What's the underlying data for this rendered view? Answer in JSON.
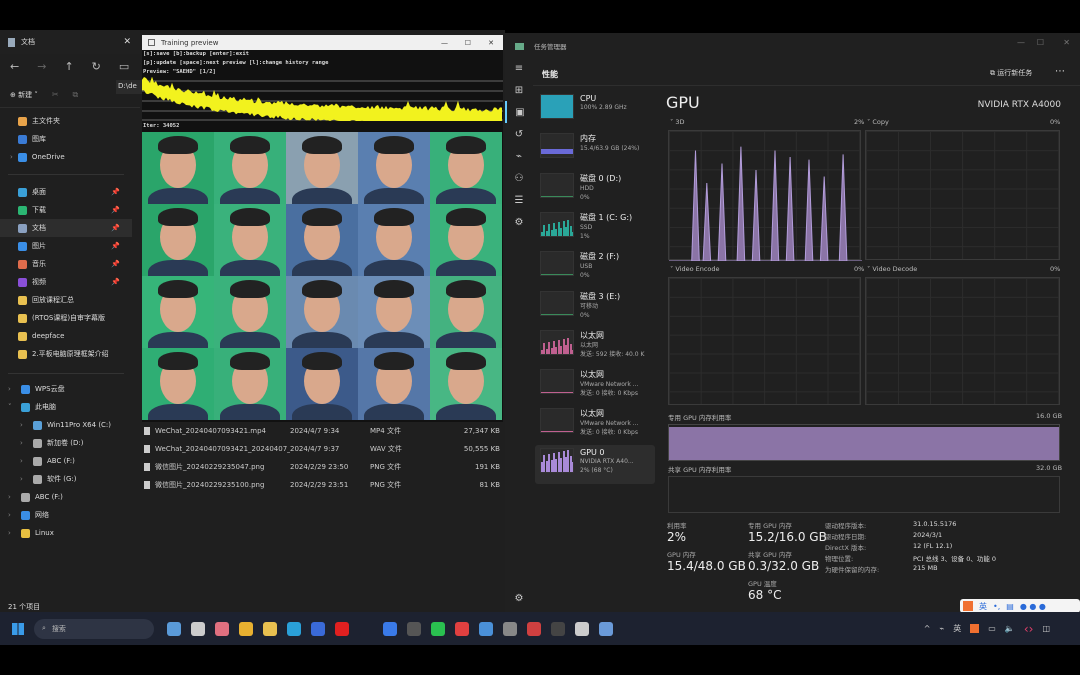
{
  "explorer": {
    "title": "文档",
    "path": "D:\\de",
    "new_label": "新建",
    "quick": [
      {
        "label": "主文件夹",
        "color": "#e8a34a"
      },
      {
        "label": "图库",
        "color": "#3a7bd5"
      },
      {
        "label": "OneDrive",
        "color": "#3a8ee6"
      }
    ],
    "pinned": [
      {
        "label": "桌面",
        "color": "#3aa0d8"
      },
      {
        "label": "下载",
        "color": "#2bb673"
      },
      {
        "label": "文档",
        "color": "#8aa0c0"
      },
      {
        "label": "图片",
        "color": "#3a8ee6"
      },
      {
        "label": "音乐",
        "color": "#e06c4c"
      },
      {
        "label": "视频",
        "color": "#8a4fd8"
      }
    ],
    "folders": [
      "回放课程汇总",
      "(RTOS课程)自审字幕版",
      "deepface",
      "2.平板电脑原理框架介绍"
    ],
    "tree": [
      "WPS云盘",
      "此电脑",
      "Win11Pro X64 (C:)",
      "新加卷 (D:)",
      "ABC (F:)",
      "软件 (G:)",
      "ABC (F:)",
      "网络",
      "Linux"
    ],
    "status": "21 个项目",
    "files": [
      {
        "name": "WeChat_20240407093421.mp4",
        "date": "2024/4/7 9:34",
        "type": "MP4 文件",
        "size": "27,347 KB"
      },
      {
        "name": "WeChat_20240407093421_20240407_...",
        "date": "2024/4/7 9:37",
        "type": "WAV 文件",
        "size": "50,555 KB"
      },
      {
        "name": "微信图片_20240229235047.png",
        "date": "2024/2/29 23:50",
        "type": "PNG 文件",
        "size": "191 KB"
      },
      {
        "name": "微信图片_20240229235100.png",
        "date": "2024/2/29 23:51",
        "type": "PNG 文件",
        "size": "81 KB"
      }
    ]
  },
  "training": {
    "title": "Training preview",
    "line1": "[s]:save [b]:backup [enter]:exit",
    "line2": "[p]:update [space]:next preview [l]:change history range",
    "line3": "Preview: \"SAEHD\" [1/2]",
    "iter": "Iter: 34052",
    "loss_color": "#f2f21e",
    "face_bgs": [
      "#2aa56a",
      "#37b07a",
      "#8aa0b0",
      "#5a7fb0",
      "#38b07a",
      "#2aa56a",
      "#3ab27c",
      "#4a6fa0",
      "#5a7fb0",
      "#3ab27c",
      "#36b579",
      "#3ab27c",
      "#6a8ab0",
      "#6c8eb8",
      "#44b280",
      "#2fae74",
      "#38b07a",
      "#3c5a8a",
      "#5577a8",
      "#48b784"
    ]
  },
  "taskmgr": {
    "title": "任务管理器",
    "section": "性能",
    "run_task": "运行新任务",
    "items": [
      {
        "name": "CPU",
        "l2": "100% 2.89 GHz",
        "l3": "",
        "color": "#2aa1b8"
      },
      {
        "name": "内存",
        "l2": "15.4/63.9 GB (24%)",
        "l3": "",
        "color": "#6a6ad8"
      },
      {
        "name": "磁盘 0 (D:)",
        "l2": "HDD",
        "l3": "0%",
        "color": "#3a8a5a"
      },
      {
        "name": "磁盘 1 (C: G:)",
        "l2": "SSD",
        "l3": "1%",
        "color": "#2aa898"
      },
      {
        "name": "磁盘 2 (F:)",
        "l2": "USB",
        "l3": "0%",
        "color": "#3a8a5a"
      },
      {
        "name": "磁盘 3 (E:)",
        "l2": "可移动",
        "l3": "0%",
        "color": "#3a8a5a"
      },
      {
        "name": "以太网",
        "l2": "以太网",
        "l3": "发送: 592 接收: 40.0 K",
        "color": "#c06090"
      },
      {
        "name": "以太网",
        "l2": "VMware Network ...",
        "l3": "发送: 0 接收: 0 Kbps",
        "color": "#c06090"
      },
      {
        "name": "以太网",
        "l2": "VMware Network ...",
        "l3": "发送: 0 接收: 0 Kbps",
        "color": "#c06090"
      },
      {
        "name": "GPU 0",
        "l2": "NVIDIA RTX A40...",
        "l3": "2% (68 °C)",
        "color": "#a98ad8"
      }
    ],
    "gpu": {
      "title": "GPU",
      "model": "NVIDIA RTX A4000",
      "g3d": "3D",
      "g3d_pct": "2%",
      "copy": "Copy",
      "copy_pct": "0%",
      "venc": "Video Encode",
      "venc_pct": "0%",
      "vdec": "Video Decode",
      "vdec_pct": "0%",
      "ded_label": "专用 GPU 内存利用率",
      "ded_max": "16.0 GB",
      "ded_fill": 0.95,
      "sh_label": "共享 GPU 内存利用率",
      "sh_max": "32.0 GB",
      "history_3d_pct": [
        0,
        0,
        0,
        0,
        0,
        0,
        0,
        85,
        0,
        0,
        60,
        0,
        0,
        0,
        75,
        0,
        0,
        0,
        0,
        88,
        0,
        0,
        0,
        70,
        0,
        0,
        0,
        0,
        85,
        0,
        0,
        0,
        80,
        0,
        0,
        0,
        0,
        78,
        0,
        0,
        0,
        65,
        0,
        0,
        0,
        0,
        82,
        0,
        0,
        0,
        0,
        0
      ],
      "stats": {
        "util_l": "利用率",
        "util_v": "2%",
        "mem_l": "GPU 内存",
        "mem_v": "15.4/48.0 GB",
        "ded_l": "专用 GPU 内存",
        "ded_v": "15.2/16.0 GB",
        "sh_l": "共享 GPU 内存",
        "sh_v": "0.3/32.0 GB",
        "temp_l": "GPU 温度",
        "temp_v": "68 °C"
      },
      "info": [
        {
          "k": "驱动程序版本:",
          "v": "31.0.15.5176"
        },
        {
          "k": "驱动程序日期:",
          "v": "2024/3/1"
        },
        {
          "k": "DirectX 版本:",
          "v": "12 (FL 12.1)"
        },
        {
          "k": "物理位置:",
          "v": "PCI 总线 3、设备 0、功能 0"
        },
        {
          "k": "为硬件保留的内存:",
          "v": "215 MB"
        }
      ]
    }
  },
  "taskbar": {
    "search": "搜索",
    "ime": "英",
    "tray_ime": "英"
  }
}
